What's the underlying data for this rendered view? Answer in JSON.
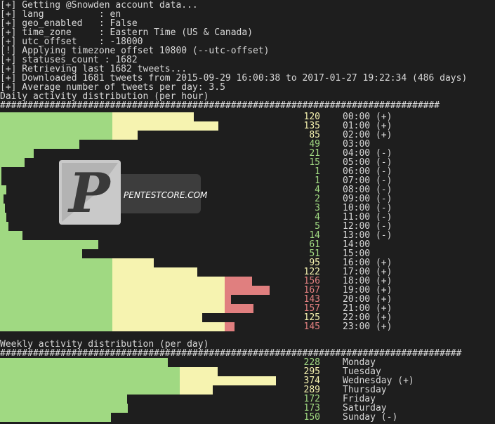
{
  "header_lines": [
    "[+] Getting @Snowden account data...",
    "[+] lang          : en",
    "[+] geo_enabled   : False",
    "[+] time_zone     : Eastern Time (US & Canada)",
    "[+] utc_offset    : -18000",
    "[!] Applying timezone offset 10800 (--utc-offset)",
    "[+] statuses_count : 1682",
    "[+] Retrieving last 1682 tweets...",
    "[+] Downloaded 1681 tweets from 2015-09-29 16:00:38 to 2017-01-27 19:22:34 (486 days)",
    "[+] Average number of tweets per day: 3.5"
  ],
  "daily": {
    "title": "Daily activity distribution (per hour)",
    "separator": "################################################################################",
    "rows": [
      {
        "count": "120",
        "label": "00:00",
        "mark": "(+)"
      },
      {
        "count": "135",
        "label": "01:00",
        "mark": "(+)"
      },
      {
        "count": "85",
        "label": "02:00",
        "mark": "(+)"
      },
      {
        "count": "49",
        "label": "03:00",
        "mark": ""
      },
      {
        "count": "21",
        "label": "04:00",
        "mark": "(-)"
      },
      {
        "count": "15",
        "label": "05:00",
        "mark": "(-)"
      },
      {
        "count": "1",
        "label": "06:00",
        "mark": "(-)"
      },
      {
        "count": "1",
        "label": "07:00",
        "mark": "(-)"
      },
      {
        "count": "4",
        "label": "08:00",
        "mark": "(-)"
      },
      {
        "count": "2",
        "label": "09:00",
        "mark": "(-)"
      },
      {
        "count": "3",
        "label": "10:00",
        "mark": "(-)"
      },
      {
        "count": "4",
        "label": "11:00",
        "mark": "(-)"
      },
      {
        "count": "5",
        "label": "12:00",
        "mark": "(-)"
      },
      {
        "count": "14",
        "label": "13:00",
        "mark": "(-)"
      },
      {
        "count": "61",
        "label": "14:00",
        "mark": ""
      },
      {
        "count": "51",
        "label": "15:00",
        "mark": ""
      },
      {
        "count": "95",
        "label": "16:00",
        "mark": "(+)"
      },
      {
        "count": "122",
        "label": "17:00",
        "mark": "(+)"
      },
      {
        "count": "156",
        "label": "18:00",
        "mark": "(+)"
      },
      {
        "count": "167",
        "label": "19:00",
        "mark": "(+)"
      },
      {
        "count": "143",
        "label": "20:00",
        "mark": "(+)"
      },
      {
        "count": "157",
        "label": "21:00",
        "mark": "(+)"
      },
      {
        "count": "125",
        "label": "22:00",
        "mark": "(+)"
      },
      {
        "count": "145",
        "label": "23:00",
        "mark": "(+)"
      }
    ]
  },
  "weekly": {
    "title": "Weekly activity distribution (per day)",
    "separator": "####################################################################################",
    "rows": [
      {
        "count": "228",
        "label": "Monday",
        "mark": ""
      },
      {
        "count": "295",
        "label": "Tuesday",
        "mark": ""
      },
      {
        "count": "374",
        "label": "Wednesday",
        "mark": "(+)"
      },
      {
        "count": "289",
        "label": "Thursday",
        "mark": ""
      },
      {
        "count": "172",
        "label": "Friday",
        "mark": ""
      },
      {
        "count": "173",
        "label": "Saturday",
        "mark": ""
      },
      {
        "count": "150",
        "label": "Sunday",
        "mark": "(-)"
      }
    ]
  },
  "watermark": {
    "text": "PENTESTCORE.COM",
    "logo_letter": "P"
  },
  "colors": {
    "green": "#a0d982",
    "yellow": "#f6f3b0",
    "red": "#e07f7f",
    "background": "#1e1e1e",
    "text": "#d8d8d8"
  }
}
